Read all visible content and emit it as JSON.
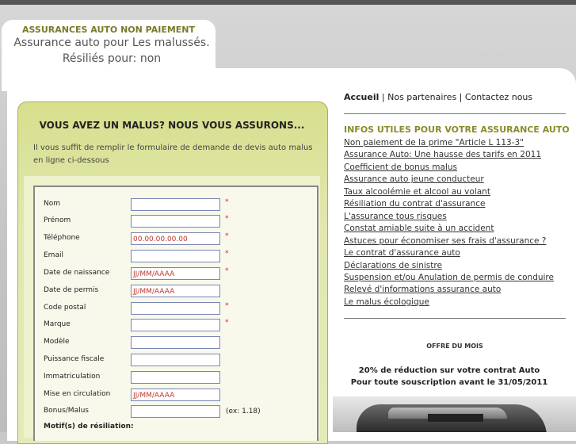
{
  "header": {
    "tag": "ASSURANCES AUTO NON PAIEMENT",
    "tagline": "Assurance auto pour Les malussés. Résiliés pour: non paiement,alcoolémie,sinistres..."
  },
  "form": {
    "title": "VOUS AVEZ UN MALUS?  NOUS VOUS ASSURONS...",
    "intro": "Il vous suffit de remplir le formulaire de demande de devis auto malus en ligne ci-dessous",
    "fields": [
      {
        "label": "Nom",
        "value": "",
        "required": "*"
      },
      {
        "label": "Prénom",
        "value": "",
        "required": "*"
      },
      {
        "label": "Téléphone",
        "value": "00.00.00.00.00",
        "required": "*"
      },
      {
        "label": "Email",
        "value": "",
        "required": "*"
      },
      {
        "label": "Date de naissance",
        "value": "JJ/MM/AAAA",
        "required": "*"
      },
      {
        "label": "Date de permis",
        "value": "JJ/MM/AAAA",
        "required": ""
      },
      {
        "label": "Code postal",
        "value": "",
        "required": "*"
      },
      {
        "label": "Marque",
        "value": "",
        "required": "*"
      },
      {
        "label": "Modèle",
        "value": "",
        "required": ""
      },
      {
        "label": "Puissance fiscale",
        "value": "",
        "required": ""
      },
      {
        "label": "Immatriculation",
        "value": "",
        "required": ""
      },
      {
        "label": "Mise en circulation",
        "value": "JJ/MM/AAAA",
        "required": ""
      },
      {
        "label": "Bonus/Malus",
        "value": "",
        "required": ""
      }
    ],
    "bonus_hint": "(ex: 1.18)",
    "motif_label": "Motif(s) de résiliation:"
  },
  "nav": {
    "accueil": "Accueil",
    "partenaires": "Nos partenaires",
    "contact": "Contactez nous"
  },
  "info": {
    "title": "INFOS UTILES POUR VOTRE ASSURANCE AUTO",
    "links": [
      "Non paiement de la prime \"Article L 113-3\"",
      "Assurance Auto: Une hausse des tarifs en 2011",
      "Coefficient de bonus malus",
      "Assurance auto jeune conducteur",
      "Taux alcoolémie et alcool au volant",
      "Résiliation du contrat d'assurance",
      "L'assurance tous risques",
      "Constat amiable suite à un accident",
      "Astuces pour économiser ses frais d'assurance ?",
      "Le contrat d'assurance auto",
      "Déclarations de sinistre",
      "Suspension et/ou Anulation de permis de conduire",
      "Relevé d'informations assurance auto",
      "Le malus écologique"
    ]
  },
  "offer": {
    "title": "OFFRE DU MOIS",
    "line1": "20% de réduction sur votre contrat Auto",
    "line2": "Pour toute souscription avant le 31/05/2011"
  }
}
